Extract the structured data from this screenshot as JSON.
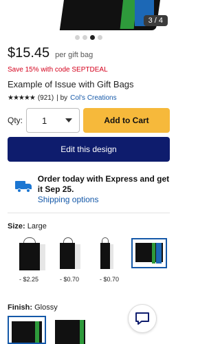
{
  "gallery": {
    "counter": "3 / 4",
    "dots_total": 4,
    "dots_active_index": 2
  },
  "product": {
    "price": "$15.45",
    "price_unit": "per gift bag",
    "promo": "Save 15% with code SEPTDEAL",
    "title": "Example of Issue with Gift Bags",
    "stars": "★★★★★",
    "reviews": "(921)",
    "by_prefix": "| by",
    "creator": "Col's Creations"
  },
  "purchase": {
    "qty_label": "Qty:",
    "qty_value": "1",
    "add_to_cart": "Add to Cart",
    "edit_design": "Edit this design"
  },
  "shipping": {
    "headline": "Order today with Express and get it Sep 25.",
    "link": "Shipping options"
  },
  "size": {
    "label": "Size:",
    "value": "Large",
    "options": [
      {
        "price": "- $2.25"
      },
      {
        "price": "- $0.70"
      },
      {
        "price": "- $0.70"
      },
      {
        "price": ""
      }
    ]
  },
  "finish": {
    "label": "Finish:",
    "value": "Glossy"
  },
  "colors": {
    "accent_blue": "#1458a8",
    "navy_button": "#0e1c6d",
    "cart_button": "#f6b93b",
    "promo_red": "#d4001c"
  }
}
